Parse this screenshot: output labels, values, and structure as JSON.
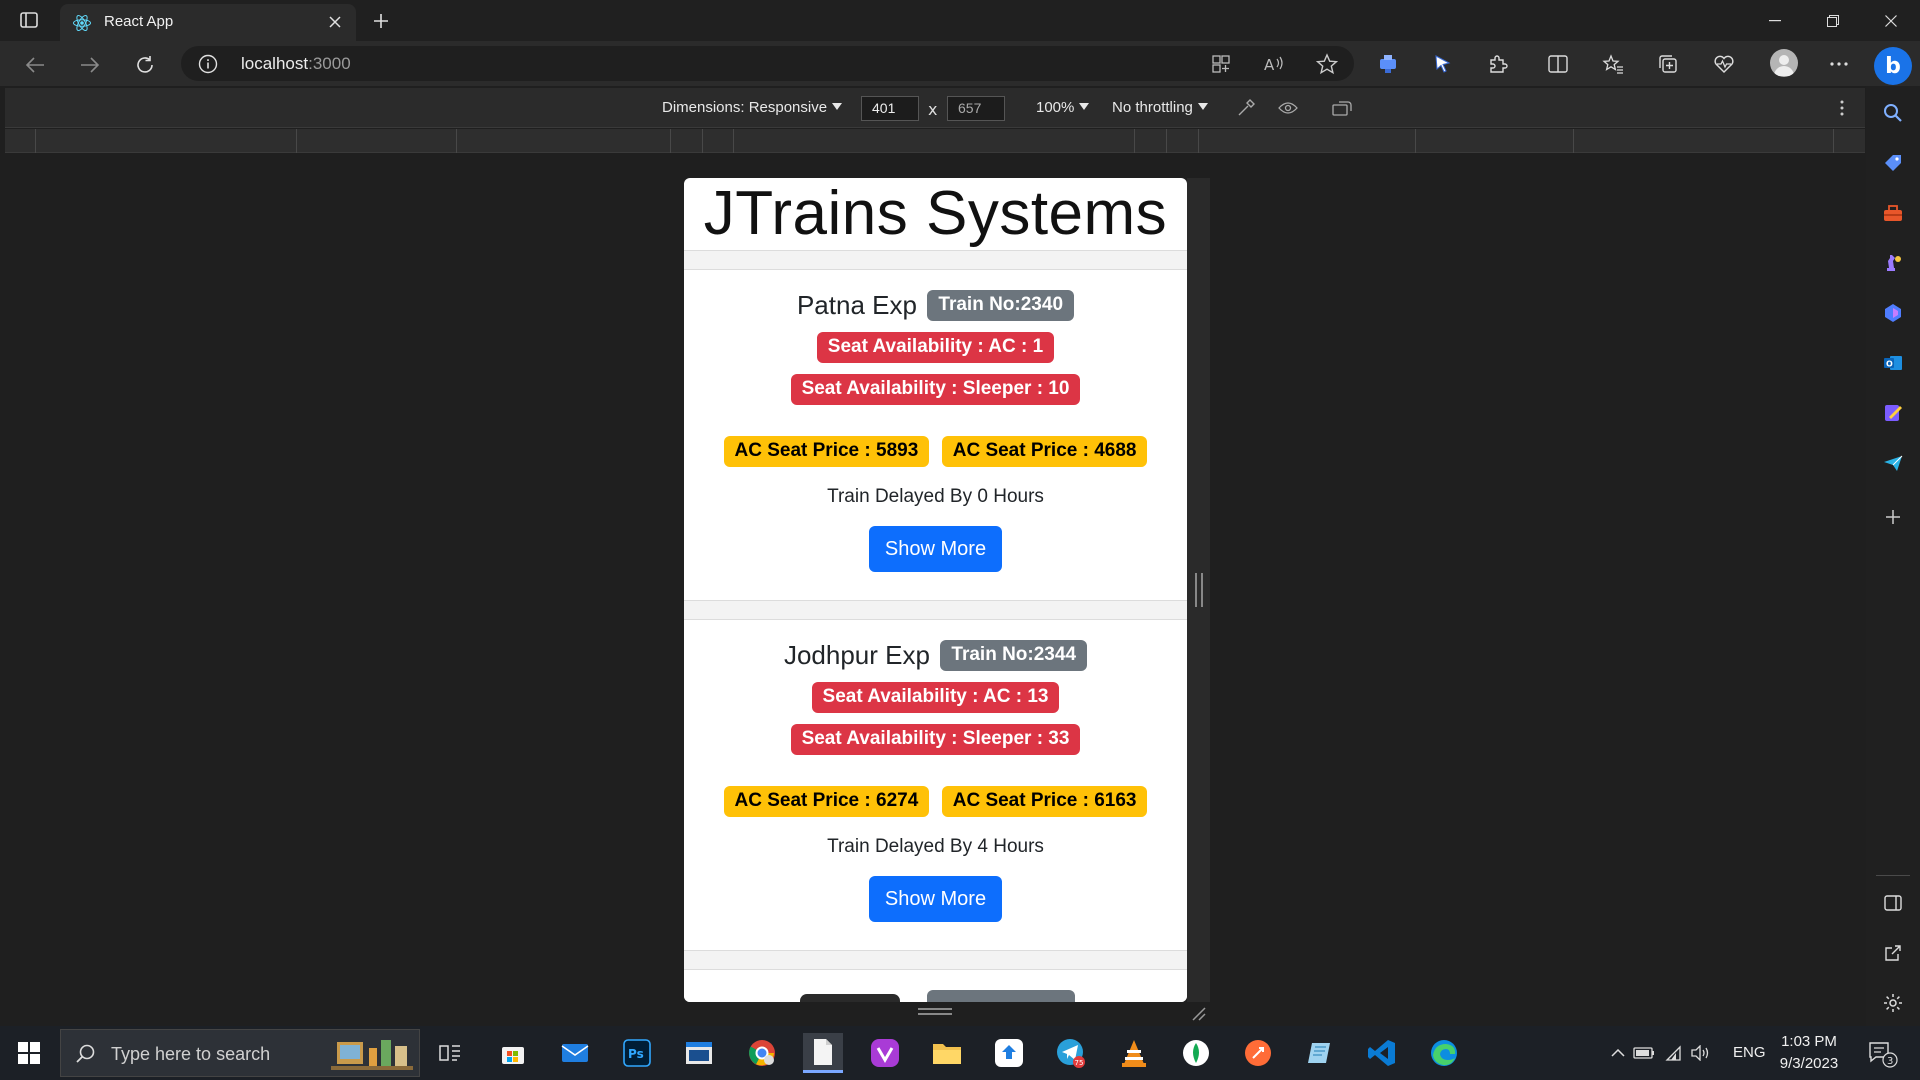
{
  "browser": {
    "tab_title": "React App",
    "url_host": "localhost",
    "url_port": ":3000"
  },
  "device_toolbar": {
    "dimensions_label": "Dimensions: Responsive",
    "width": "401",
    "height": "657",
    "separator": "x",
    "zoom": "100%",
    "throttling": "No throttling"
  },
  "page": {
    "title": "JTrains Systems",
    "trains": [
      {
        "name": "Patna Exp",
        "train_no": "Train No:2340",
        "seat_ac": "Seat Availability : AC : 1",
        "seat_sleeper": "Seat Availability : Sleeper : 10",
        "price_1": "AC Seat Price : 5893",
        "price_2": "AC Seat Price : 4688",
        "delay": "Train Delayed By 0 Hours",
        "button": "Show More"
      },
      {
        "name": "Jodhpur Exp",
        "train_no": "Train No:2344",
        "seat_ac": "Seat Availability : AC : 13",
        "seat_sleeper": "Seat Availability : Sleeper : 33",
        "price_1": "AC Seat Price : 6274",
        "price_2": "AC Seat Price : 6163",
        "delay": "Train Delayed By 4 Hours",
        "button": "Show More"
      }
    ]
  },
  "taskbar": {
    "search_placeholder": "Type here to search",
    "language": "ENG",
    "time": "1:03 PM",
    "date": "9/3/2023",
    "notification_count": "3",
    "telegram_badge": "75"
  },
  "icons": {
    "sidebar": [
      "search-icon",
      "tag-icon",
      "toolbox-icon",
      "chess-icon",
      "copilot-icon",
      "outlook-icon",
      "designer-icon",
      "send-icon",
      "add-icon",
      "panel-icon",
      "external-link-icon",
      "settings-icon"
    ]
  },
  "colors": {
    "primary": "#0d6efd",
    "danger": "#dc3545",
    "warning": "#ffc107",
    "secondary": "#6c757d"
  }
}
